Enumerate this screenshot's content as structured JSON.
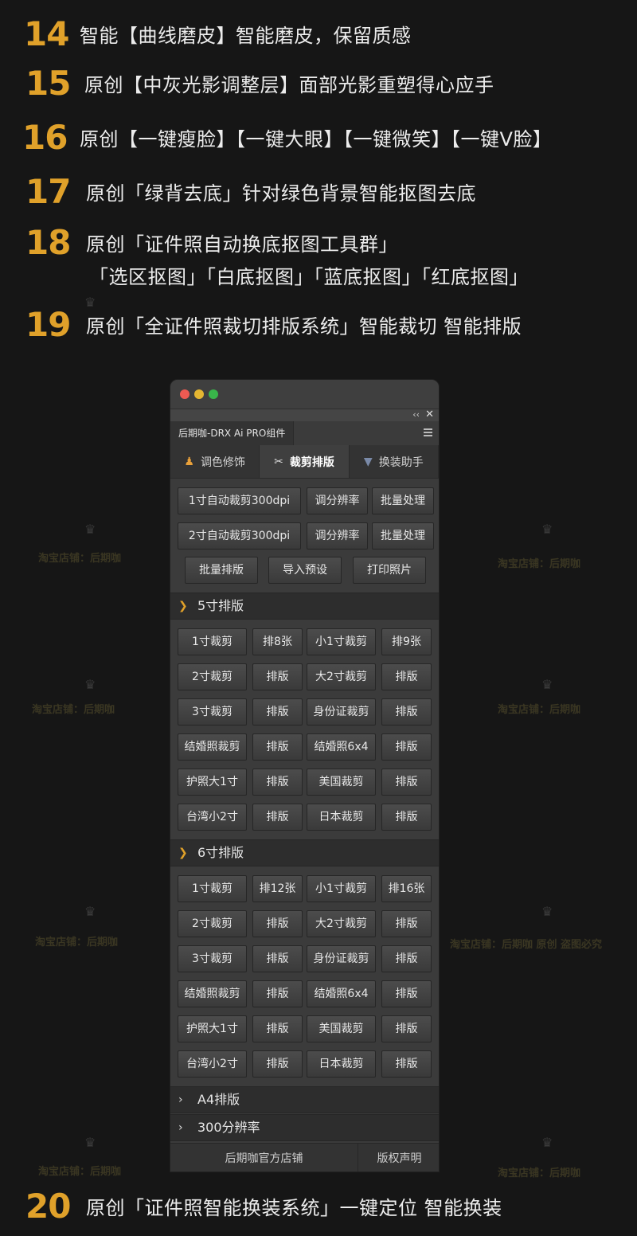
{
  "features": [
    {
      "num": "14",
      "text": "智能【曲线磨皮】智能磨皮，保留质感"
    },
    {
      "num": "15",
      "text": "原创【中灰光影调整层】面部光影重塑得心应手"
    },
    {
      "num": "16",
      "text": "原创【一键瘦脸】【一键大眼】【一键微笑】【一键V脸】"
    },
    {
      "num": "17",
      "text": "原创「绿背去底」针对绿色背景智能抠图去底"
    },
    {
      "num": "18",
      "text": "原创「证件照自动换底抠图工具群」",
      "line2": "「选区抠图」「白底抠图」「蓝底抠图」「红底抠图」"
    },
    {
      "num": "19",
      "text": "原创「全证件照裁切排版系统」智能裁切  智能排版"
    },
    {
      "num": "20",
      "text": "原创「证件照智能换装系统」一键定位 智能换装"
    }
  ],
  "watermark": {
    "shop": "淘宝店铺：后期咖",
    "shop_long": "淘宝店铺：后期咖 原创 盗图必究"
  },
  "panel": {
    "plugin_title": "后期咖-DRX Ai PRO组件",
    "tabs": [
      {
        "label": "调色修饰",
        "icon": "person-icon"
      },
      {
        "label": "裁剪排版",
        "icon": "scissors-icon"
      },
      {
        "label": "换装助手",
        "icon": "suit-icon"
      }
    ],
    "top_buttons": [
      [
        "1寸自动裁剪300dpi",
        "调分辨率",
        "批量处理"
      ],
      [
        "2寸自动裁剪300dpi",
        "调分辨率",
        "批量处理"
      ],
      [
        "批量排版",
        "导入预设",
        "打印照片"
      ]
    ],
    "section5": {
      "title": "5寸排版",
      "rows": [
        [
          "1寸裁剪",
          "排8张",
          "小1寸裁剪",
          "排9张"
        ],
        [
          "2寸裁剪",
          "排版",
          "大2寸裁剪",
          "排版"
        ],
        [
          "3寸裁剪",
          "排版",
          "身份证裁剪",
          "排版"
        ],
        [
          "结婚照裁剪",
          "排版",
          "结婚照6x4",
          "排版"
        ],
        [
          "护照大1寸",
          "排版",
          "美国裁剪",
          "排版"
        ],
        [
          "台湾小2寸",
          "排版",
          "日本裁剪",
          "排版"
        ]
      ]
    },
    "section6": {
      "title": "6寸排版",
      "rows": [
        [
          "1寸裁剪",
          "排12张",
          "小1寸裁剪",
          "排16张"
        ],
        [
          "2寸裁剪",
          "排版",
          "大2寸裁剪",
          "排版"
        ],
        [
          "3寸裁剪",
          "排版",
          "身份证裁剪",
          "排版"
        ],
        [
          "结婚照裁剪",
          "排版",
          "结婚照6x4",
          "排版"
        ],
        [
          "护照大1寸",
          "排版",
          "美国裁剪",
          "排版"
        ],
        [
          "台湾小2寸",
          "排版",
          "日本裁剪",
          "排版"
        ]
      ]
    },
    "section_a4": {
      "title": "A4排版"
    },
    "section_dpi": {
      "title": "300分辨率"
    },
    "footer": {
      "store": "后期咖官方店铺",
      "copyright": "版权声明"
    }
  },
  "colors": {
    "accent": "#e0a12a",
    "background": "#161616",
    "panel": "#3b3b3b"
  }
}
